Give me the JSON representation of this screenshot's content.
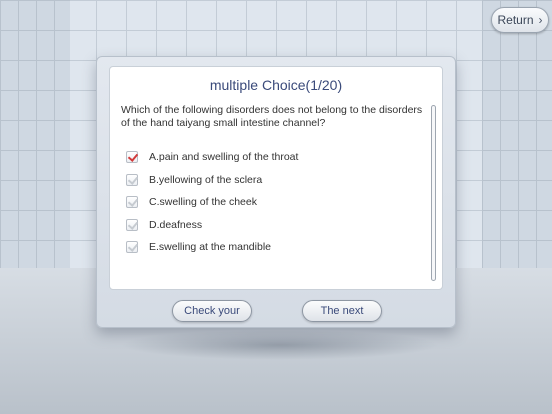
{
  "header": {
    "return_label": "Return"
  },
  "quiz": {
    "title": "multiple Choice(1/20)",
    "question": "Which of the following disorders does not belong to the disorders of the hand taiyang small intestine channel?",
    "options": [
      {
        "label": "A.pain and swelling of the throat",
        "checked": true
      },
      {
        "label": "B.yellowing of the sclera",
        "checked": false
      },
      {
        "label": "C.swelling of the cheek",
        "checked": false
      },
      {
        "label": "D.deafness",
        "checked": false
      },
      {
        "label": "E.swelling at the mandible",
        "checked": false
      }
    ]
  },
  "actions": {
    "check_label": "Check your",
    "next_label": "The next"
  }
}
